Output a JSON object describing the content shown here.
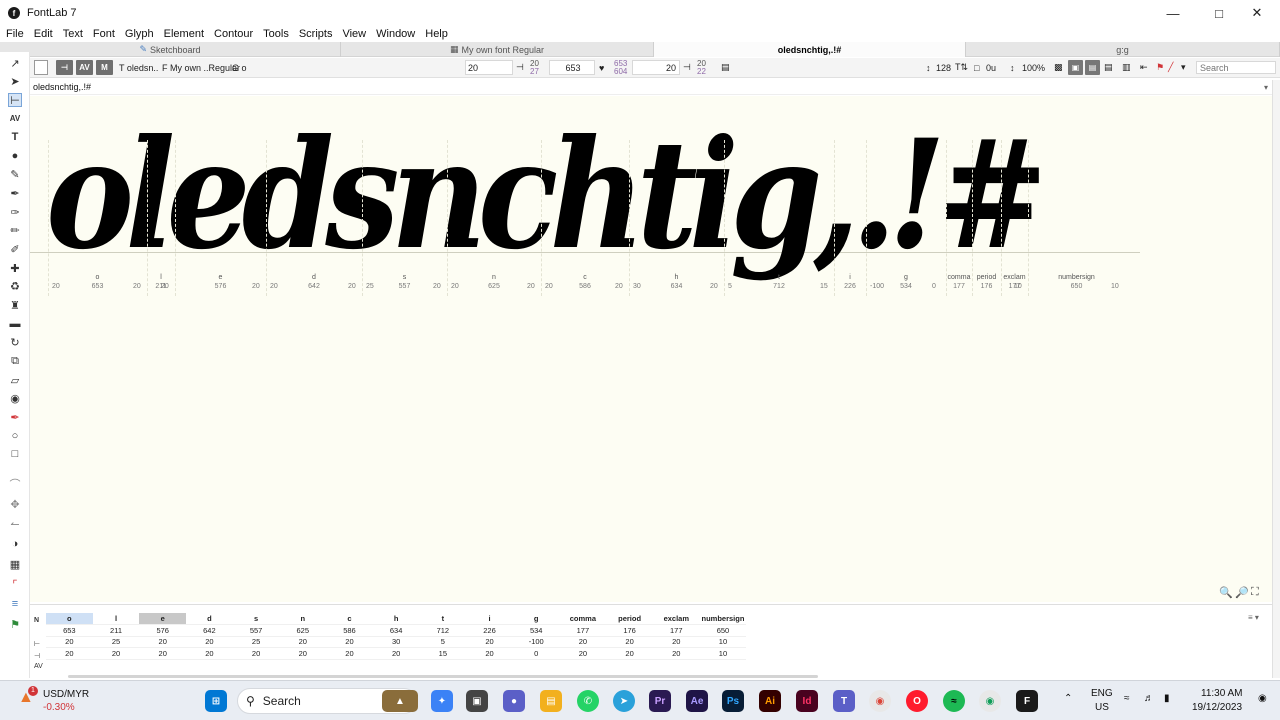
{
  "window": {
    "title": "FontLab 7"
  },
  "menu": [
    "File",
    "Edit",
    "Text",
    "Font",
    "Glyph",
    "Element",
    "Contour",
    "Tools",
    "Scripts",
    "View",
    "Window",
    "Help"
  ],
  "tabs": [
    {
      "label": "Sketchboard",
      "active": false
    },
    {
      "label": "My own font Regular",
      "active": false
    },
    {
      "label": "oledsnchtig,.!#",
      "active": true
    },
    {
      "label": "g:g",
      "active": false
    }
  ],
  "toolbar": {
    "text_label": "T oledsn..",
    "font_label": "F My own ..Regular",
    "glyph_label": "G o",
    "lsb": "20",
    "lsb_small_top": "20",
    "lsb_small_bottom": "27",
    "advance": "653",
    "adv_small_top": "653",
    "adv_small_bottom": "604",
    "rsb": "20",
    "rsb_small_top": "20",
    "rsb_small_bottom": "22",
    "zoom_size": "128",
    "units": "0u",
    "zoom_percent": "100%",
    "search_placeholder": "Search"
  },
  "textline": {
    "value": "oledsnchtig,.!#"
  },
  "canvas_text": "oledsnchtig,.!#",
  "glyphs": [
    {
      "name": "o",
      "lsb": "20",
      "adv": "653",
      "rsb": "20"
    },
    {
      "name": "l",
      "lsb": "",
      "adv": "211",
      "rsb": "20"
    },
    {
      "name": "e",
      "lsb": "",
      "adv": "576",
      "rsb": "20"
    },
    {
      "name": "d",
      "lsb": "20",
      "adv": "642",
      "rsb": "20"
    },
    {
      "name": "s",
      "lsb": "25",
      "adv": "557",
      "rsb": "20"
    },
    {
      "name": "n",
      "lsb": "20",
      "adv": "625",
      "rsb": "20"
    },
    {
      "name": "c",
      "lsb": "20",
      "adv": "586",
      "rsb": "20"
    },
    {
      "name": "h",
      "lsb": "30",
      "adv": "634",
      "rsb": "20"
    },
    {
      "name": "t",
      "lsb": "5",
      "adv": "712",
      "rsb": "15"
    },
    {
      "name": "i",
      "lsb": "",
      "adv": "226",
      "rsb": ""
    },
    {
      "name": "g",
      "lsb": "-100",
      "adv": "534",
      "rsb": "0"
    },
    {
      "name": "comma",
      "lsb": "",
      "adv": "177",
      "rsb": ""
    },
    {
      "name": "period",
      "lsb": "",
      "adv": "176",
      "rsb": ""
    },
    {
      "name": "exclam",
      "lsb": "",
      "adv": "177",
      "rsb": "10"
    },
    {
      "name": "numbersign",
      "lsb": "",
      "adv": "650",
      "rsb": "10"
    }
  ],
  "metrics_table": {
    "row_labels": [
      "N",
      "⊢",
      "⊣",
      "AV"
    ],
    "headers": [
      "o",
      "l",
      "e",
      "d",
      "s",
      "n",
      "c",
      "h",
      "t",
      "i",
      "g",
      "comma",
      "period",
      "exclam",
      "numbersign"
    ],
    "advance": [
      "653",
      "211",
      "576",
      "642",
      "557",
      "625",
      "586",
      "634",
      "712",
      "226",
      "534",
      "177",
      "176",
      "177",
      "650"
    ],
    "lsb": [
      "20",
      "25",
      "20",
      "20",
      "25",
      "20",
      "20",
      "30",
      "5",
      "20",
      "-100",
      "20",
      "20",
      "20",
      "10"
    ],
    "rsb": [
      "20",
      "20",
      "20",
      "20",
      "20",
      "20",
      "20",
      "20",
      "15",
      "20",
      "0",
      "20",
      "20",
      "20",
      "10"
    ]
  },
  "taskbar": {
    "ticker": "USD/MYR",
    "ticker_change": "-0.30%",
    "ticker_badge": "1",
    "search_label": "Search",
    "lang_top": "ENG",
    "lang_bottom": "US",
    "time": "11:30 AM",
    "date": "19/12/2023"
  },
  "colors": {
    "canvas": "#fdfdf3",
    "accent": "#7aa5d8",
    "ticker_negative": "#d13438"
  }
}
